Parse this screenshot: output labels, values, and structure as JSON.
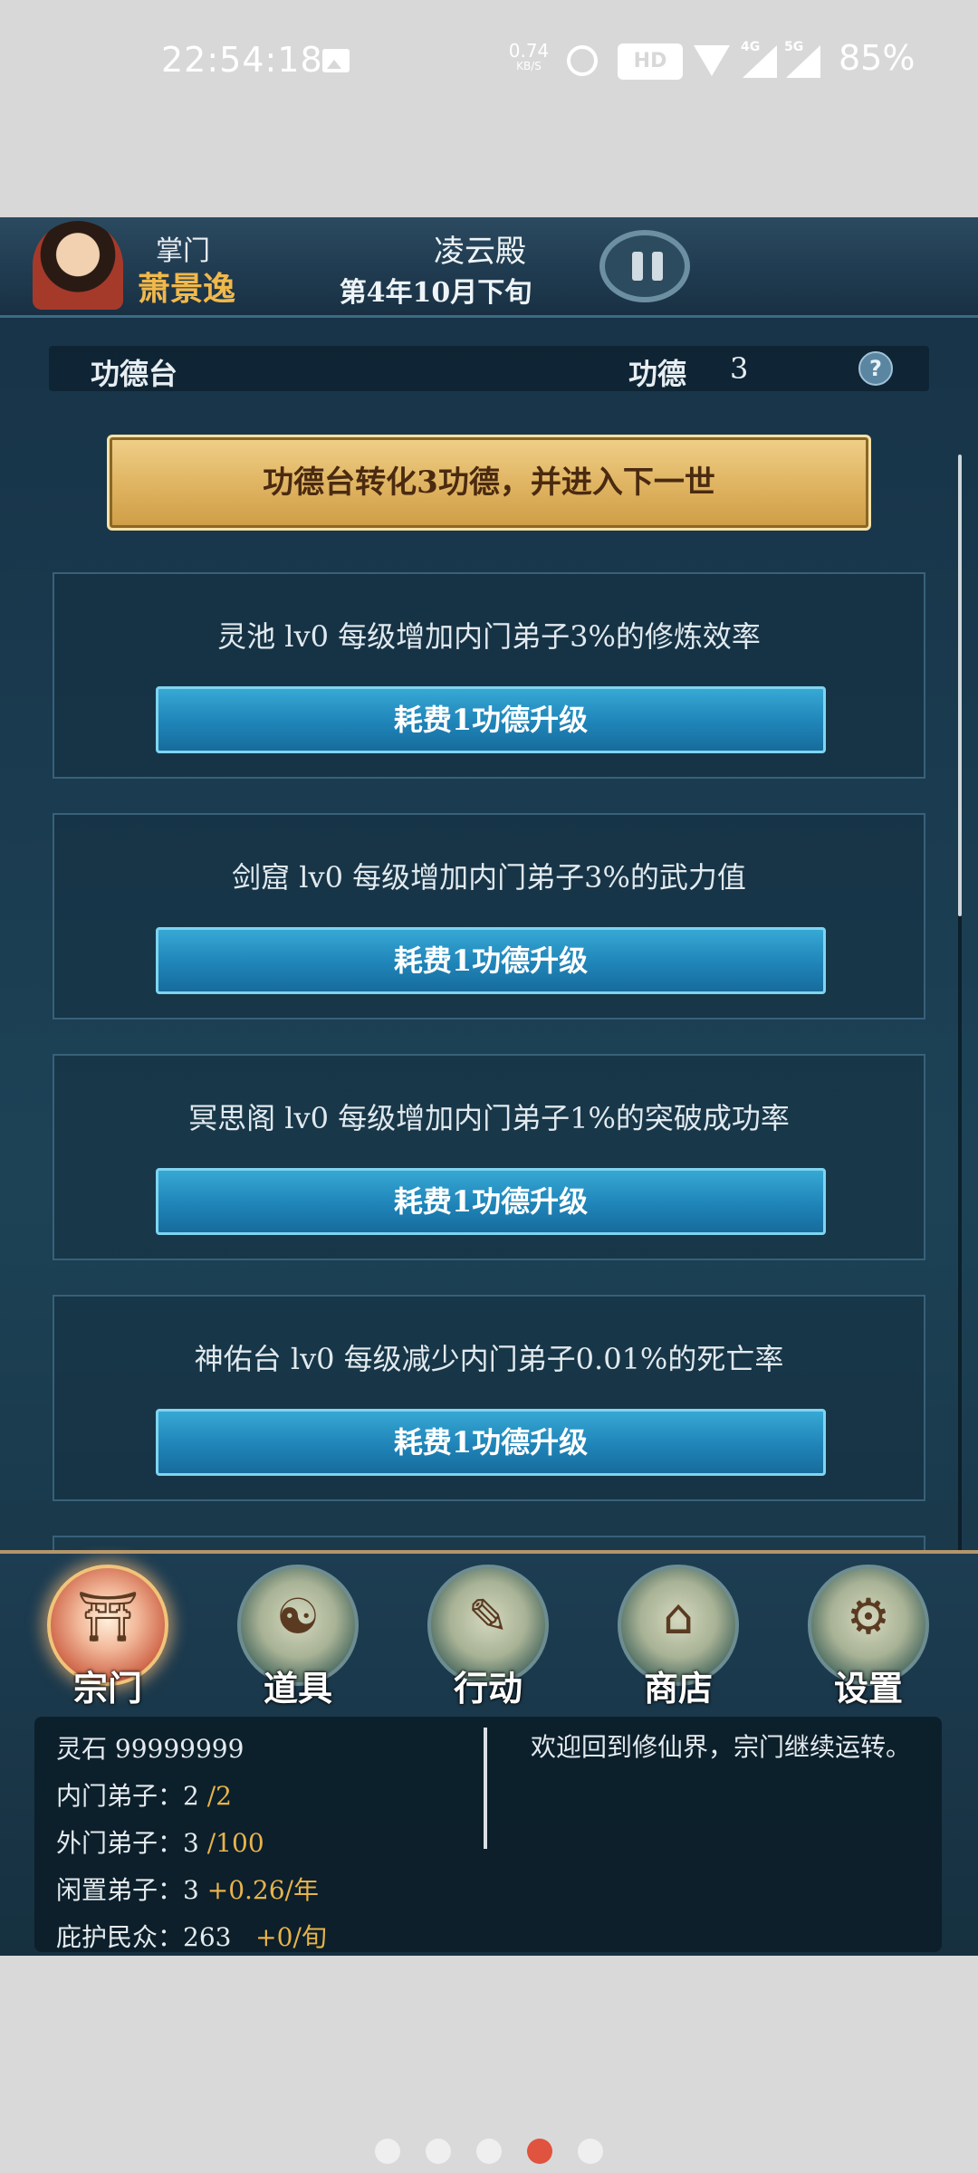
{
  "status_bar": {
    "time": "22:54:18",
    "net_speed_value": "0.74",
    "net_speed_unit": "KB/S",
    "hd_label": "HD",
    "net_4g": "4G",
    "net_5g": "5G",
    "battery": "85%"
  },
  "header": {
    "role_title": "掌门",
    "player_name": "萧景逸",
    "sect_name": "凌云殿",
    "game_date": "第4年10月下旬"
  },
  "merit_panel": {
    "title": "功德台",
    "merit_label": "功德",
    "merit_value": "3",
    "help_symbol": "?",
    "convert_button": "功德台转化3功德，并进入下一世"
  },
  "upgrades": [
    {
      "description": "灵池 lv0 每级增加内门弟子3%的修炼效率",
      "button": "耗费1功德升级"
    },
    {
      "description": "剑窟 lv0 每级增加内门弟子3%的武力值",
      "button": "耗费1功德升级"
    },
    {
      "description": "冥思阁 lv0 每级增加内门弟子1%的突破成功率",
      "button": "耗费1功德升级"
    },
    {
      "description": "神佑台 lv0 每级减少内门弟子0.01%的死亡率",
      "button": "耗费1功德升级"
    }
  ],
  "nav": [
    {
      "label": "宗门",
      "icon": "sect-gate-icon",
      "active": true
    },
    {
      "label": "道具",
      "icon": "money-bag-icon",
      "active": false
    },
    {
      "label": "行动",
      "icon": "action-scroll-icon",
      "active": false
    },
    {
      "label": "商店",
      "icon": "shop-building-icon",
      "active": false
    },
    {
      "label": "设置",
      "icon": "gear-icon",
      "active": false
    }
  ],
  "stats": {
    "spirit_stone_label": "灵石",
    "spirit_stone_value": "99999999",
    "inner_label": "内门弟子：",
    "inner_current": "2",
    "inner_max": "/2",
    "outer_label": "外门弟子：",
    "outer_current": "3",
    "outer_max": "/100",
    "idle_label": "闲置弟子：",
    "idle_current": "3",
    "idle_rate": "+0.26/年",
    "protected_label": "庇护民众：",
    "protected_current": "263",
    "protected_rate": "+0/旬"
  },
  "message": "欢迎回到修仙界，宗门继续运转。",
  "pager": {
    "count": 5,
    "active_index": 3
  },
  "colors": {
    "accent_gold": "#e8b34a",
    "button_blue": "#1f84b8",
    "pager_active": "#e0533f"
  }
}
